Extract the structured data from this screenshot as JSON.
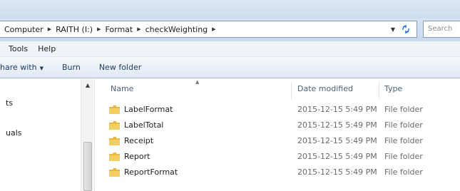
{
  "address": {
    "crumbs": [
      "Computer",
      "RAITH (I:)",
      "Format",
      "checkWeighting"
    ],
    "search_placeholder": "Search"
  },
  "menu": [
    "Tools",
    "Help"
  ],
  "toolbar": {
    "share_label": "hare with",
    "burn_label": "Burn",
    "new_folder_label": "New folder"
  },
  "nav": {
    "items": [
      "ts",
      "uals"
    ]
  },
  "columns": {
    "name": "Name",
    "date": "Date modified",
    "type": "Type"
  },
  "files": [
    {
      "name": "LabelFormat",
      "date": "2015-12-15 5:49 PM",
      "type": "File folder"
    },
    {
      "name": "LabelTotal",
      "date": "2015-12-15 5:49 PM",
      "type": "File folder"
    },
    {
      "name": "Receipt",
      "date": "2015-12-15 5:49 PM",
      "type": "File folder"
    },
    {
      "name": "Report",
      "date": "2015-12-15 5:49 PM",
      "type": "File folder"
    },
    {
      "name": "ReportFormat",
      "date": "2015-12-15 5:49 PM",
      "type": "File folder"
    }
  ],
  "icons": {
    "folder": "folder-icon",
    "refresh": "refresh-icon",
    "breadcrumb_separator": "chevron-right-icon"
  },
  "colors": {
    "folder_yellow": "#e8b93a",
    "chrome_blue": "#cddcee",
    "header_text": "#4c607a"
  }
}
